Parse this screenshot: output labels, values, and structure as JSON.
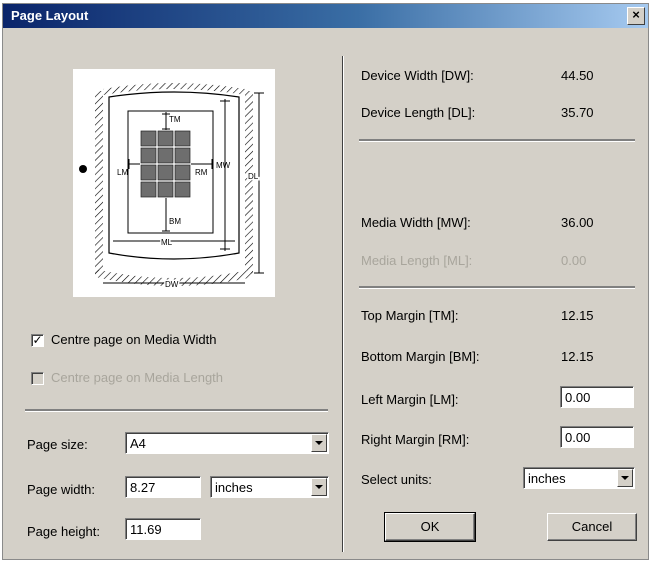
{
  "window": {
    "title": "Page Layout",
    "close_glyph": "×"
  },
  "diagram": {
    "labels": {
      "tm": "TM",
      "bm": "BM",
      "lm": "LM",
      "rm": "RM",
      "mw": "MW",
      "ml": "ML",
      "dl": "DL",
      "dw": "DW"
    }
  },
  "options": {
    "centre_width": {
      "label": "Centre page on Media Width",
      "checked": true
    },
    "centre_length": {
      "label": "Centre page on Media Length",
      "checked": false,
      "disabled": true
    }
  },
  "page": {
    "size_label": "Page size:",
    "size_value": "A4",
    "width_label": "Page width:",
    "width_value": "8.27",
    "width_units": "inches",
    "height_label": "Page height:",
    "height_value": "11.69"
  },
  "device": {
    "width_label": "Device Width [DW]:",
    "width_value": "44.50",
    "length_label": "Device Length [DL]:",
    "length_value": "35.70"
  },
  "media": {
    "width_label": "Media Width [MW]:",
    "width_value": "36.00",
    "length_label": "Media Length [ML]:",
    "length_value": "0.00"
  },
  "margins": {
    "top_label": "Top Margin [TM]:",
    "top_value": "12.15",
    "bottom_label": "Bottom Margin [BM]:",
    "bottom_value": "12.15",
    "left_label": "Left Margin [LM]:",
    "left_value": "0.00",
    "right_label": "Right Margin [RM]:",
    "right_value": "0.00"
  },
  "units": {
    "label": "Select units:",
    "value": "inches"
  },
  "buttons": {
    "ok": "OK",
    "cancel": "Cancel"
  },
  "colors": {
    "title_start": "#0a246a",
    "title_end": "#a6caf0",
    "face": "#d4d0c8"
  }
}
